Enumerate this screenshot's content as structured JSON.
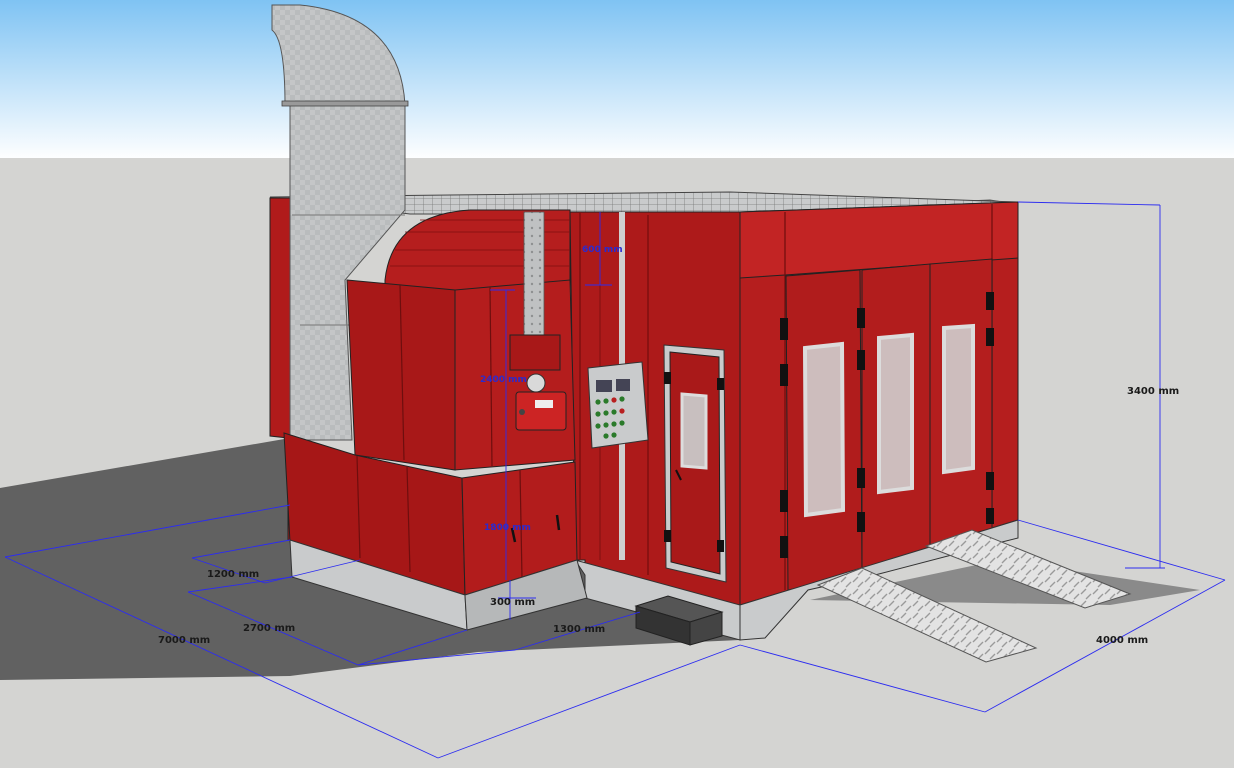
{
  "colors": {
    "sky_top": "#7fc3f3",
    "sky_bottom": "#ffffff",
    "ground": "#d4d4d2",
    "shadow": "#616161",
    "booth_red": "#b31c1c",
    "booth_red_dark": "#8a1414",
    "booth_red_light": "#c62828",
    "steel": "#c9cbcc",
    "dimension_line": "#2c2cf0"
  },
  "dimensions": {
    "total_length": "7000 mm",
    "total_width": "4000 mm",
    "total_height": "3400 mm",
    "heater_depth": "1200 mm",
    "heater_length": "2700 mm",
    "base_height": "300 mm",
    "gap_length": "1300 mm",
    "top_gap": "600 mm",
    "heater_height": "2400 mm",
    "lower_height": "1800 mm"
  }
}
